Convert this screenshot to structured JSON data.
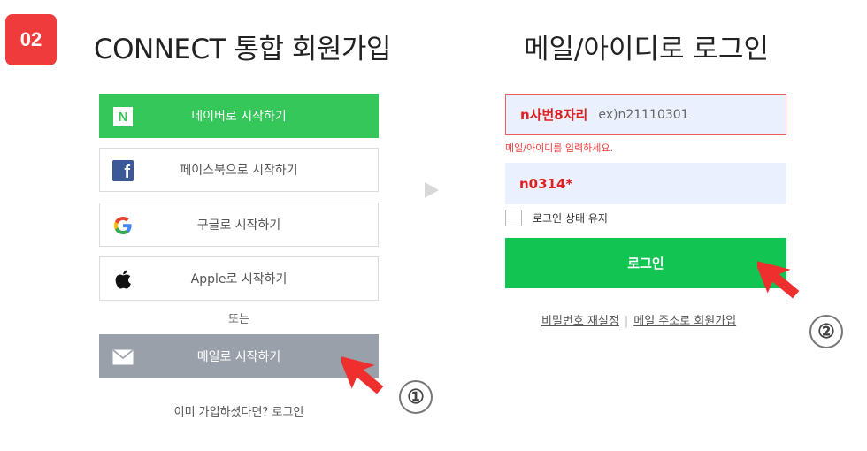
{
  "step_badge": "02",
  "left": {
    "title": "CONNECT 통합 회원가입",
    "buttons": {
      "naver": "네이버로 시작하기",
      "naver_icon": "N",
      "facebook": "페이스북으로 시작하기",
      "facebook_icon": "f",
      "google": "구글로 시작하기",
      "google_icon": "G",
      "apple": "Apple로 시작하기",
      "email": "메일로 시작하기"
    },
    "or_text": "또는",
    "already_text": "이미 가입하셨다면? ",
    "login_link": "로그인"
  },
  "right": {
    "title": "메일/아이디로 로그인",
    "id_value": "n사번8자리",
    "id_placeholder": "ex)n21110301",
    "id_error": "메일/아이디를 입력하세요.",
    "pw_value": "n0314*",
    "keep_login": "로그인 상태 유지",
    "login_button": "로그인",
    "reset_password": "비밀번호 재설정",
    "separator": "|",
    "email_signup": "메일 주소로 회원가입"
  },
  "annotations": {
    "marker_1": "①",
    "marker_2": "②"
  },
  "colors": {
    "badge": "#ef3b3b",
    "naver": "#35c759",
    "email_button": "#99a0aa",
    "login_button": "#12c553",
    "input_bg": "#eaf0fd",
    "error": "#ef3b3b",
    "pointer_arrow": "#ef2e2e"
  }
}
